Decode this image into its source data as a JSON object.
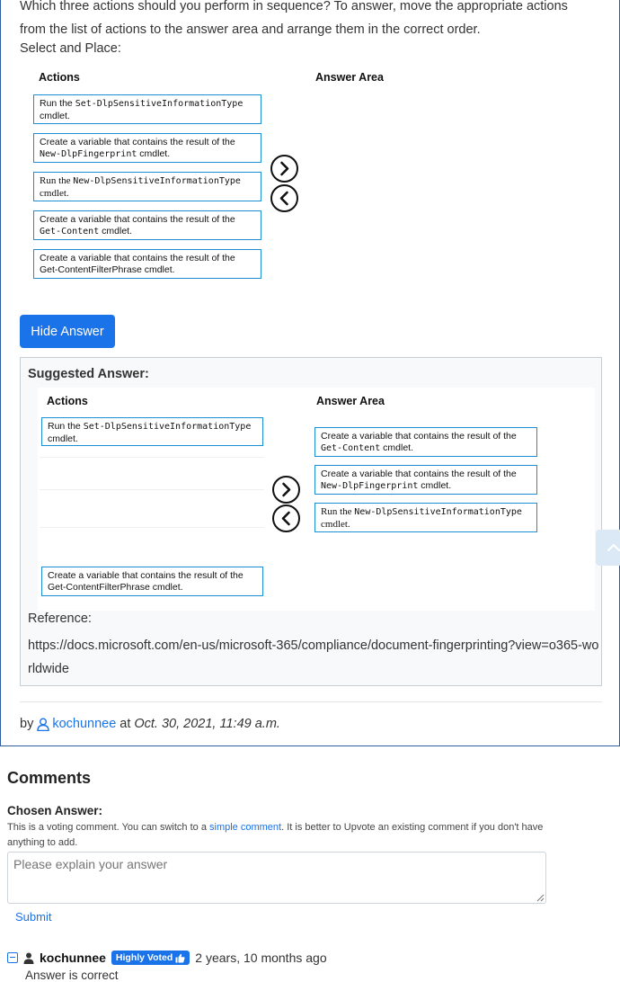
{
  "question": {
    "text": "Which three actions should you perform in sequence? To answer, move the appropriate actions from the list of actions to the answer area and arrange them in the correct order.",
    "select_place": "Select and Place:",
    "actions_heading": "Actions",
    "answer_area_heading": "Answer Area",
    "actions": [
      {
        "prefix": "Run the ",
        "code": "Set-DlpSensitiveInformationType",
        "suffix": "cmdlet."
      },
      {
        "prefix": "Create a variable that contains the result of the",
        "code": "New-DlpFingerprint",
        "suffix": " cmdlet."
      },
      {
        "prefix": "Run the ",
        "code": "New-DlpSensitiveInformationType",
        "suffix": "cmdlet."
      },
      {
        "prefix": "Create a variable that contains the result of the",
        "code": "Get-Content",
        "suffix": " cmdlet."
      },
      {
        "prefix": "Create a variable that contains the result of the",
        "code": "",
        "suffix": "Get-ContentFilterPhrase cmdlet."
      }
    ]
  },
  "hide_answer_label": "Hide Answer",
  "suggested": {
    "title": "Suggested Answer:",
    "actions_heading": "Actions",
    "answer_area_heading": "Answer Area",
    "remaining": [
      {
        "prefix": "Run the ",
        "code": "Set-DlpSensitiveInformationType",
        "suffix": "cmdlet."
      },
      {
        "prefix": "Create a variable that contains the result of the",
        "code": "",
        "suffix": "Get-ContentFilterPhrase cmdlet."
      }
    ],
    "answer": [
      {
        "prefix": "Create a variable that contains the result of the",
        "code": "Get-Content",
        "suffix": " cmdlet."
      },
      {
        "prefix": "Create a variable that contains the result of the",
        "code": "New-DlpFingerprint",
        "suffix": " cmdlet."
      },
      {
        "prefix": "Run the ",
        "code": "New-DlpSensitiveInformationType",
        "suffix": "cmdlet."
      }
    ],
    "reference_label": "Reference:",
    "reference_url": "https://docs.microsoft.com/en-us/microsoft-365/compliance/document-fingerprinting?view=o365-worldwide"
  },
  "byline": {
    "by": "by",
    "user": "kochunnee",
    "at": "at",
    "date": "Oct. 30, 2021, 11:49 a.m."
  },
  "comments": {
    "title": "Comments",
    "chosen_label": "Chosen Answer:",
    "note_before": "This is a voting comment. You can switch to a ",
    "note_link": "simple comment",
    "note_after": ". It is better to Upvote an existing comment if you don't have anything to add.",
    "placeholder": "Please explain your answer",
    "submit_label": "Submit",
    "items": [
      {
        "user": "kochunnee",
        "badge": "Highly Voted",
        "time": "2 years, 10 months ago",
        "body": "Answer is correct"
      }
    ]
  },
  "colors": {
    "accent": "#1a73e8",
    "box_border": "#1b8ed4",
    "card_border": "#2f5d9e"
  },
  "icons": [
    "chevron-right-circle-icon",
    "chevron-left-circle-icon",
    "user-icon",
    "thumbs-up-icon",
    "collapse-icon",
    "chevron-up-icon"
  ]
}
